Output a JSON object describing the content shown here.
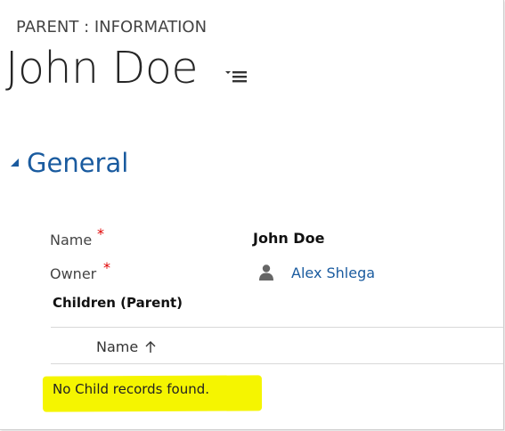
{
  "header": {
    "entity_type": "PARENT : INFORMATION",
    "record_name": "John Doe",
    "form_selector_icon": "menu-icon"
  },
  "section": {
    "title": "General",
    "collapse_icon": "triangle-icon"
  },
  "fields": [
    {
      "label": "Name",
      "required_marker": "*",
      "value": "John Doe"
    },
    {
      "label": "Owner",
      "required_marker": "*",
      "value": "Alex Shlega",
      "icon": "user-icon"
    }
  ],
  "subgrid": {
    "title": "Children (Parent)",
    "columns": [
      {
        "label": "Name",
        "sort": "ascending",
        "sort_icon": "arrow-up-icon"
      }
    ],
    "empty_message": "No Child records found.",
    "highlight_color": "#f5f500"
  },
  "colors": {
    "accent": "#1a5b9f",
    "required": "#e00000"
  }
}
